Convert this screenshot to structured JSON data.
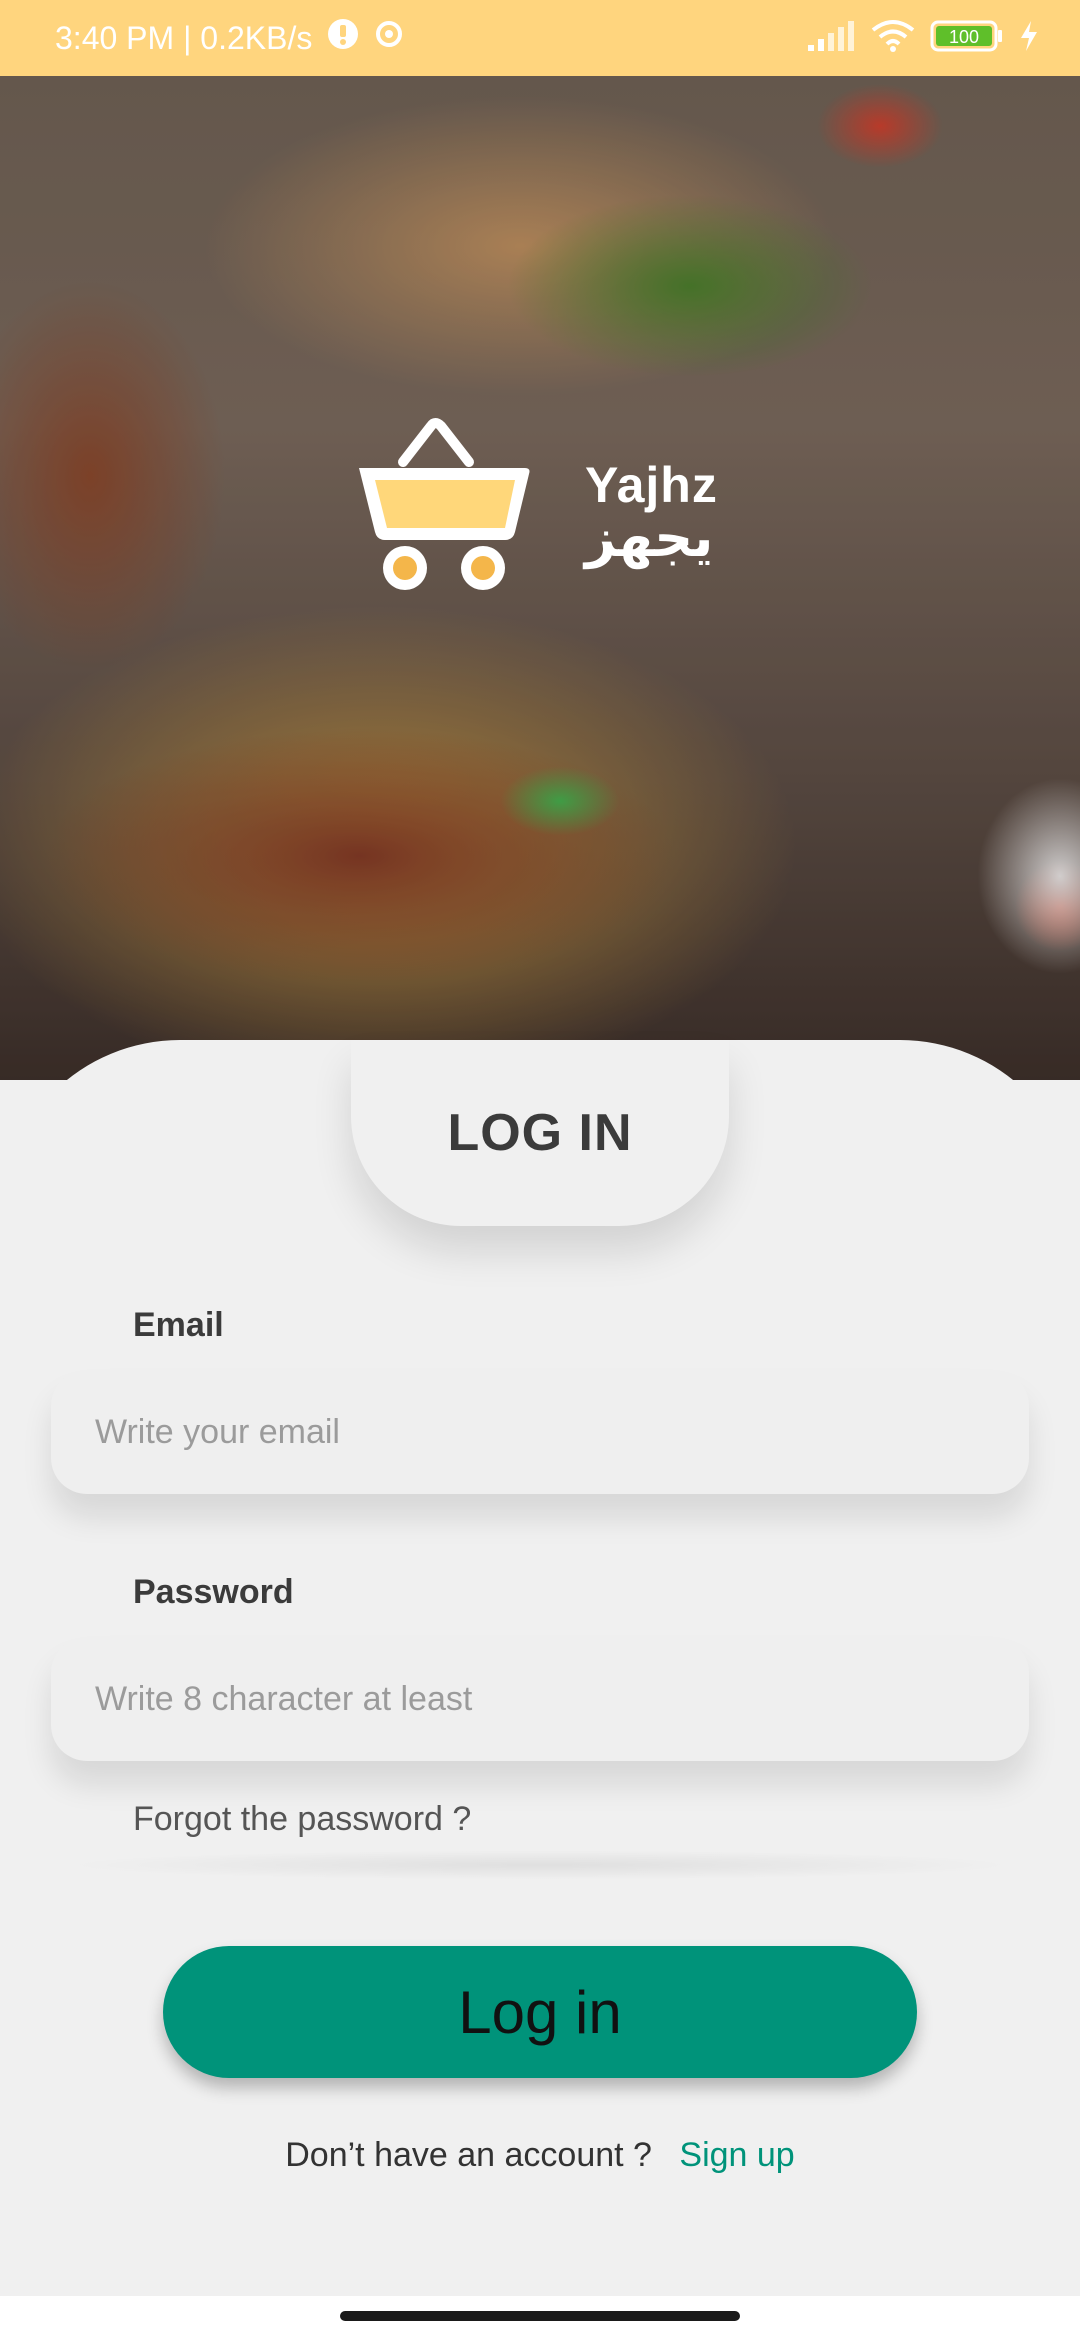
{
  "status_bar": {
    "time_speed": "3:40 PM | 0.2KB/s",
    "battery": "100",
    "icons": [
      "alert-icon",
      "sync-icon",
      "signal-icon",
      "wifi-icon",
      "battery-icon",
      "charging-icon"
    ]
  },
  "logo": {
    "text_en": "Yajhz",
    "text_ar": "يجهز",
    "icon": "shopping-cart-icon"
  },
  "tab": {
    "label": "LOG IN"
  },
  "form": {
    "email_label": "Email",
    "email_placeholder": "Write your email",
    "password_label": "Password",
    "password_placeholder": "Write 8 character at least",
    "forgot_text": "Forgot the password ?",
    "login_button": "Log in"
  },
  "signup": {
    "prompt": "Don’t have an account ?",
    "link": "Sign up"
  },
  "colors": {
    "status_bar": "#ffd57e",
    "primary": "#00937a",
    "background": "#f0f0f0"
  }
}
